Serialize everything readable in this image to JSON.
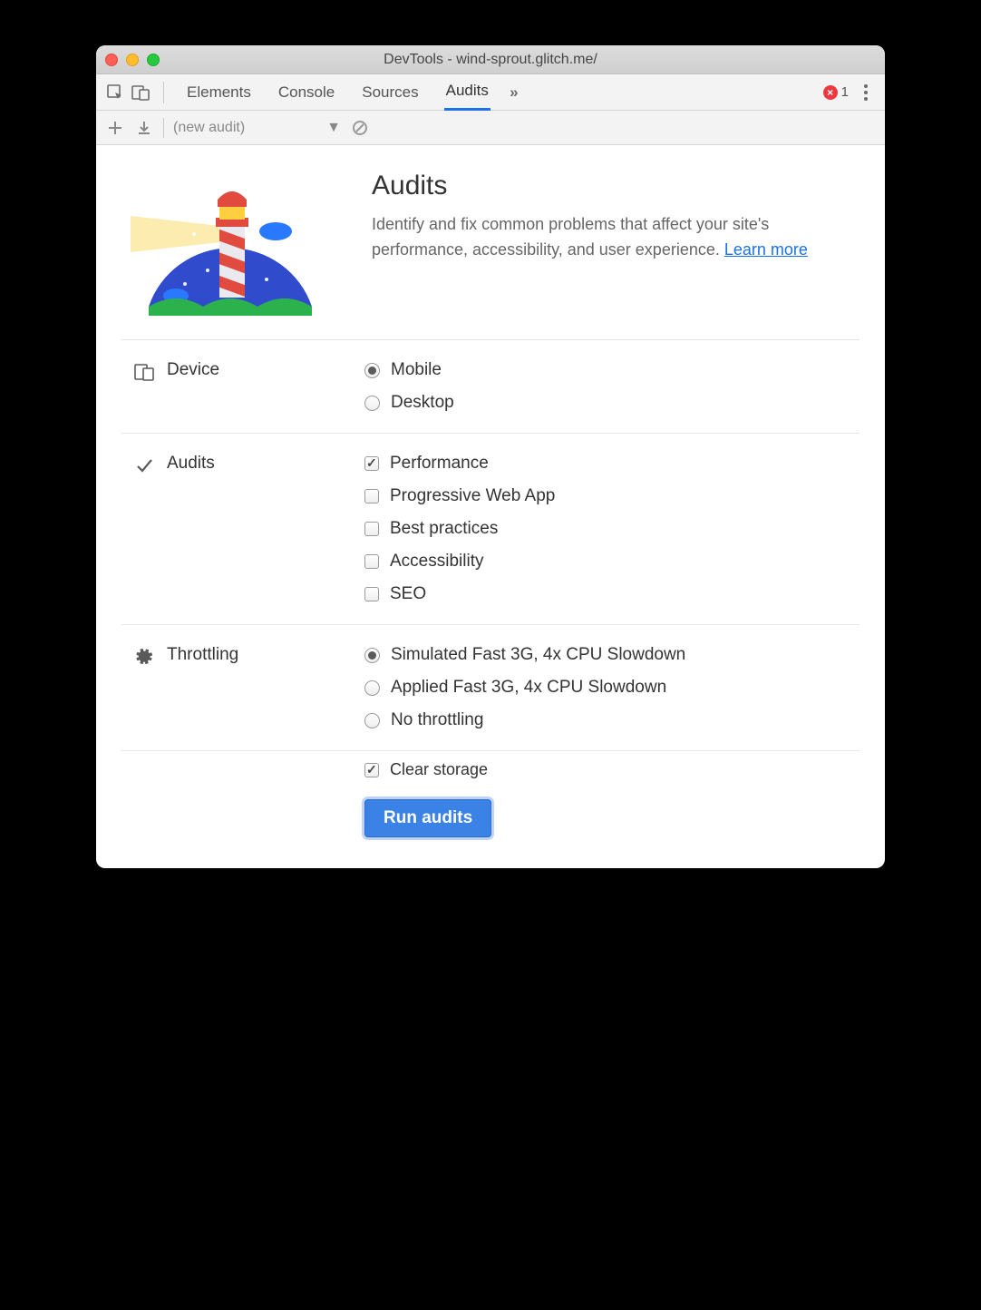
{
  "window": {
    "title": "DevTools - wind-sprout.glitch.me/"
  },
  "tabs": {
    "elements": "Elements",
    "console": "Console",
    "sources": "Sources",
    "audits": "Audits"
  },
  "errors": {
    "count": "1"
  },
  "sec_toolbar": {
    "current": "(new audit)"
  },
  "hero": {
    "title": "Audits",
    "desc_prefix": "Identify and fix common problems that affect your site's performance, accessibility, and user experience. ",
    "learn_more": "Learn more"
  },
  "device": {
    "label": "Device",
    "mobile": "Mobile",
    "desktop": "Desktop"
  },
  "audits": {
    "label": "Audits",
    "performance": "Performance",
    "pwa": "Progressive Web App",
    "best": "Best practices",
    "a11y": "Accessibility",
    "seo": "SEO"
  },
  "throttling": {
    "label": "Throttling",
    "sim": "Simulated Fast 3G, 4x CPU Slowdown",
    "applied": "Applied Fast 3G, 4x CPU Slowdown",
    "none": "No throttling"
  },
  "clear_storage": "Clear storage",
  "run": "Run audits"
}
